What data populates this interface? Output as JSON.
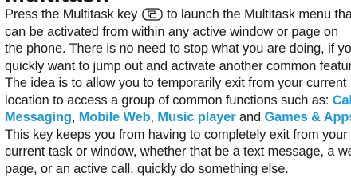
{
  "heading_fragment": "Multitask",
  "lines": {
    "l1_before": "Press the Multitask key ",
    "l1_after": " to launch the Multitask menu that",
    "l2": "can be activated from within any active window or page on",
    "l3": "the phone. There is no need to stop what you are doing, if you",
    "l4": "quickly want to jump out and activate another common feature.",
    "l5": "The idea is to allow you to temporarily exit from your current",
    "l6_before": "location to access a group of common functions such as: ",
    "l7_sep1": ", ",
    "l7_sep2": ", ",
    "l7_sep3": " and ",
    "l7_end": ".",
    "l8": "This key keeps you from having to completely exit from your",
    "l9": "current task or window, whether that be a text message, a web",
    "l10": "page, or an active call, quickly do something else."
  },
  "links": {
    "call": "Call",
    "messaging": "Messaging",
    "mobile_web": "Mobile Web",
    "music_player": "Music player",
    "games_apps": "Games & Apps"
  },
  "icons": {
    "multitask_key": "multitask-key-icon"
  },
  "colors": {
    "text": "#1a1a1a",
    "link": "#1e9ad6"
  }
}
